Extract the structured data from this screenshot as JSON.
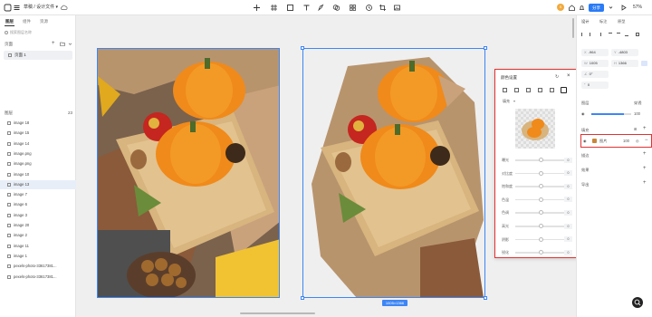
{
  "header": {
    "menu_icon": "hamburger-menu",
    "breadcrumb": "草稿 / 设计文件 ▾",
    "share_label": "分享",
    "zoom": "57%",
    "avatar_letter": "S"
  },
  "left_panel": {
    "tabs": [
      "图层",
      "组件",
      "资源"
    ],
    "search_placeholder": "搜索图层名称",
    "pages_label": "页面",
    "page_item": "页面 1",
    "layers_label": "图层",
    "layers_count": "23",
    "layers": [
      "image 18",
      "image 15",
      "image 14",
      "image.png",
      "image.png",
      "image 10",
      "image 13",
      "image 7",
      "image 6",
      "image 3",
      "image 20",
      "image 2",
      "image 11",
      "image 1",
      "pexels-photo-33617381...",
      "pexels-photo-33617381..."
    ],
    "selected_layer_index": 6
  },
  "canvas": {
    "size_badge": "1005×1366"
  },
  "adjust_panel": {
    "title": "颜色设置",
    "mode": "填充",
    "adjustments": [
      "曝光",
      "对比度",
      "饱和度",
      "色温",
      "色调",
      "高光",
      "阴影",
      "锐化"
    ],
    "values": [
      "0",
      "0",
      "0",
      "0",
      "0",
      "0",
      "0",
      "0"
    ]
  },
  "right_panel": {
    "tabs": [
      "设计",
      "标注",
      "原型"
    ],
    "x": "-964",
    "y": "-4803",
    "w": "1005",
    "h": "1366",
    "rotation": "0°",
    "radius": "0",
    "layer_label": "图层",
    "blend": "穿透",
    "opacity": "100",
    "fill_label": "填充",
    "fill_type": "图片",
    "fill_opacity": "100",
    "stroke_label": "描边",
    "shadow_label": "效果",
    "export_label": "导出"
  },
  "colors": {
    "accent": "#2a7bf6",
    "highlight": "#e03232",
    "selected_bg": "#e8eef8"
  }
}
